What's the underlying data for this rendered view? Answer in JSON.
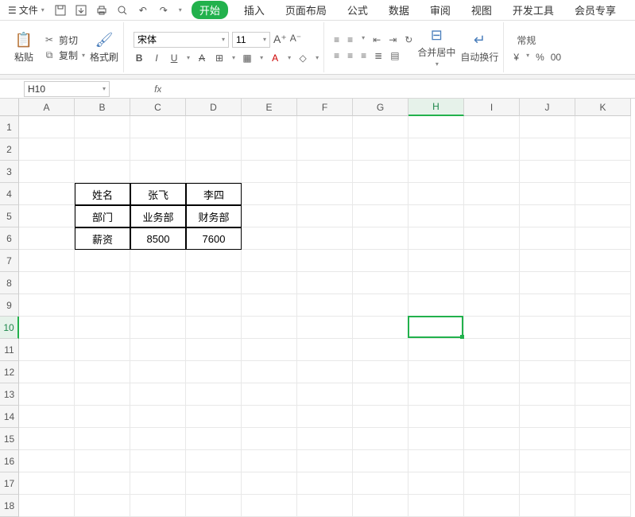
{
  "menu": {
    "file": "文件",
    "tabs": [
      "开始",
      "插入",
      "页面布局",
      "公式",
      "数据",
      "审阅",
      "视图",
      "开发工具",
      "会员专享"
    ],
    "active_idx": 0
  },
  "clipboard": {
    "paste": "粘贴",
    "cut": "剪切",
    "copy": "复制",
    "format_painter": "格式刷"
  },
  "font": {
    "name": "宋体",
    "size": "11"
  },
  "align": {
    "merge": "合并居中",
    "wrap": "自动换行"
  },
  "number_format": {
    "label": "常规"
  },
  "namebox": "H10",
  "cols": [
    "A",
    "B",
    "C",
    "D",
    "E",
    "F",
    "G",
    "H",
    "I",
    "J",
    "K"
  ],
  "rows_count": 18,
  "selected": {
    "col_idx": 7,
    "row": 10
  },
  "table": {
    "b4": "姓名",
    "c4": "张飞",
    "d4": "李四",
    "b5": "部门",
    "c5": "业务部",
    "d5": "财务部",
    "b6": "薪资",
    "c6": "8500",
    "d6": "7600"
  },
  "sym": {
    "yen": "¥",
    "pct": "%",
    "zeros": "00"
  }
}
